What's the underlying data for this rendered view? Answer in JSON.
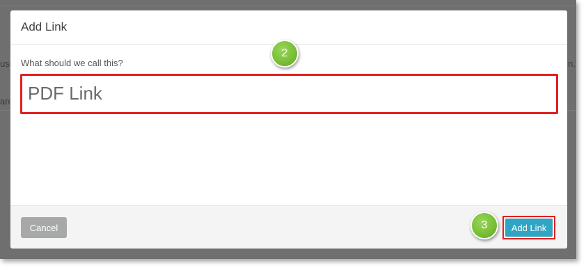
{
  "background": {
    "left_fragment_1": "use",
    "left_fragment_2": "arc",
    "right_fragment": "n."
  },
  "modal": {
    "title": "Add Link",
    "field_label": "What should we call this?",
    "link_name_value": "PDF Link",
    "cancel_label": "Cancel",
    "add_link_label": "Add Link"
  },
  "annotations": {
    "step_2": "2",
    "step_3": "3",
    "highlight_color": "#e0201f",
    "badge_color": "#76bd35"
  },
  "colors": {
    "primary_button": "#2fa5c3",
    "cancel_button": "#a7a9a9",
    "backdrop": "#6f6f6f"
  }
}
